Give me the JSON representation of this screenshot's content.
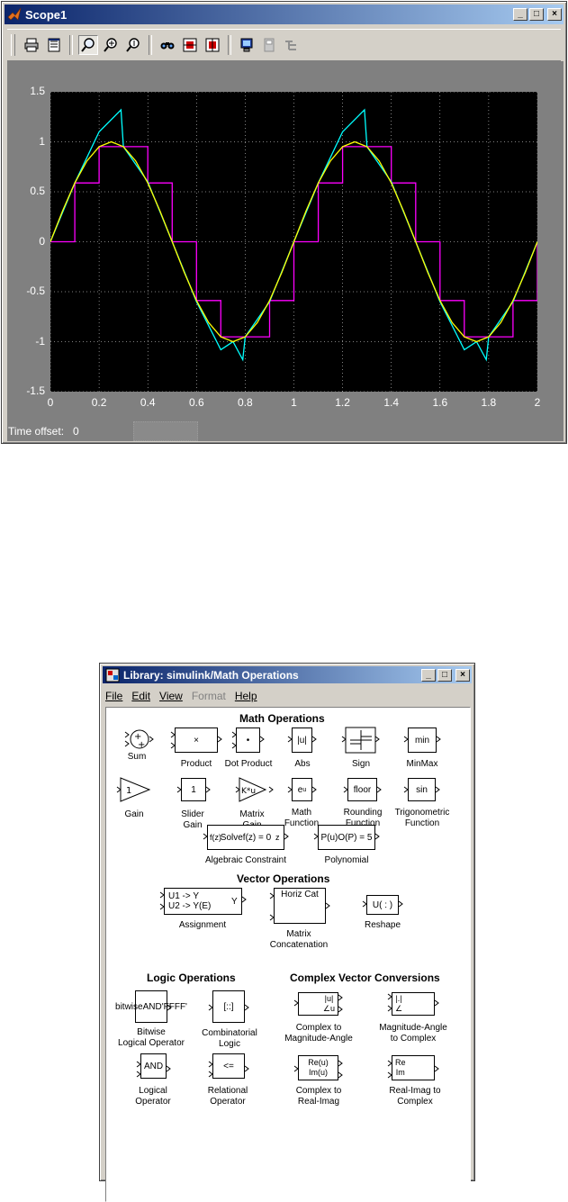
{
  "scope": {
    "title": "Scope1",
    "controls": {
      "minimize": "_",
      "maximize": "□",
      "close": "×"
    },
    "toolbar": [
      "print-icon",
      "parameters-icon",
      "zoom-icon",
      "zoom-x-icon",
      "zoom-y-icon",
      "autoscale-icon",
      "save-axes-icon",
      "restore-axes-icon",
      "floating-scope-icon",
      "lock-axes-icon",
      "signal-selection-icon"
    ],
    "time_offset_label": "Time offset:",
    "time_offset_value": "0",
    "colors": {
      "background": "#000000",
      "frame": "#808080",
      "sine": "#ffff00",
      "cyan_series": "#00ffff",
      "magenta_series": "#ff00ff"
    }
  },
  "chart_data": {
    "type": "line",
    "title": "",
    "xlim": [
      0,
      2
    ],
    "ylim": [
      -1.5,
      1.5
    ],
    "xticks": [
      "0",
      "0.2",
      "0.4",
      "0.6",
      "0.8",
      "1",
      "1.2",
      "1.4",
      "1.6",
      "1.8",
      "2"
    ],
    "yticks": [
      "1.5",
      "1",
      "0.5",
      "0",
      "-0.5",
      "-1",
      "-1.5"
    ],
    "grid": true,
    "series": [
      {
        "color": "#ffff00",
        "x": [
          0,
          0.05,
          0.1,
          0.15,
          0.2,
          0.25,
          0.3,
          0.35,
          0.4,
          0.45,
          0.5,
          0.55,
          0.6,
          0.65,
          0.7,
          0.75,
          0.8,
          0.85,
          0.9,
          0.95,
          1,
          1.05,
          1.1,
          1.15,
          1.2,
          1.25,
          1.3,
          1.35,
          1.4,
          1.45,
          1.5,
          1.55,
          1.6,
          1.65,
          1.7,
          1.75,
          1.8,
          1.85,
          1.9,
          1.95,
          2
        ],
        "y": [
          0,
          0.309,
          0.588,
          0.809,
          0.951,
          1,
          0.951,
          0.809,
          0.588,
          0.309,
          0,
          -0.309,
          -0.588,
          -0.809,
          -0.951,
          -1,
          -0.951,
          -0.809,
          -0.588,
          -0.309,
          0,
          0.309,
          0.588,
          0.809,
          0.951,
          1,
          0.951,
          0.809,
          0.588,
          0.309,
          0,
          -0.309,
          -0.588,
          -0.809,
          -0.951,
          -1,
          -0.951,
          -0.809,
          -0.588,
          -0.309,
          0
        ]
      },
      {
        "color": "#00ffff",
        "x": [
          0,
          0.1,
          0.2,
          0.29,
          0.3,
          0.4,
          0.5,
          0.6,
          0.7,
          0.75,
          0.79,
          0.8,
          0.9,
          1,
          1.1,
          1.2,
          1.29,
          1.3,
          1.4,
          1.5,
          1.6,
          1.7,
          1.75,
          1.79,
          1.8,
          1.9,
          2
        ],
        "y": [
          0,
          0.588,
          1.1,
          1.32,
          0.951,
          0.6,
          0,
          -0.6,
          -1.08,
          -1.0,
          -1.18,
          -0.951,
          -0.6,
          0,
          0.588,
          1.1,
          1.32,
          0.951,
          0.6,
          0,
          -0.6,
          -1.08,
          -1.0,
          -1.18,
          -0.951,
          -0.6,
          0
        ]
      },
      {
        "color": "#ff00ff",
        "x": [
          0,
          0.1,
          0.1,
          0.2,
          0.2,
          0.4,
          0.4,
          0.5,
          0.5,
          0.6,
          0.6,
          0.7,
          0.7,
          0.9,
          0.9,
          1,
          1,
          1.1,
          1.1,
          1.2,
          1.2,
          1.4,
          1.4,
          1.5,
          1.5,
          1.6,
          1.6,
          1.7,
          1.7,
          1.9,
          1.9,
          2,
          2
        ],
        "y": [
          0,
          0,
          0.588,
          0.588,
          0.951,
          0.951,
          0.588,
          0.588,
          0,
          0,
          -0.588,
          -0.588,
          -0.951,
          -0.951,
          -0.588,
          -0.588,
          0,
          0,
          0.588,
          0.588,
          0.951,
          0.951,
          0.588,
          0.588,
          0,
          0,
          -0.588,
          -0.588,
          -0.951,
          -0.951,
          -0.588,
          -0.588,
          0
        ]
      }
    ]
  },
  "library": {
    "title": "Library: simulink/Math Operations",
    "controls": {
      "minimize": "_",
      "maximize": "□",
      "close": "×"
    },
    "menu": [
      {
        "label": "File",
        "enabled": true
      },
      {
        "label": "Edit",
        "enabled": true
      },
      {
        "label": "View",
        "enabled": true
      },
      {
        "label": "Format",
        "enabled": false
      },
      {
        "label": "Help",
        "enabled": true
      }
    ],
    "headings": {
      "math": "Math Operations",
      "vector": "Vector Operations",
      "logic": "Logic Operations",
      "complex": "Complex Vector Conversions"
    },
    "blocks": {
      "sum": {
        "label": "Sum"
      },
      "product": {
        "label": "Product",
        "icon": "×"
      },
      "dot_product": {
        "label": "Dot Product",
        "icon": "•"
      },
      "abs": {
        "label": "Abs",
        "icon": "|u|"
      },
      "sign": {
        "label": "Sign"
      },
      "minmax": {
        "label": "MinMax",
        "icon": "min"
      },
      "gain": {
        "label": "Gain",
        "icon": "1"
      },
      "slider_gain": {
        "label1": "Slider",
        "label2": "Gain",
        "icon": "1"
      },
      "matrix_gain": {
        "label1": "Matrix",
        "label2": "Gain",
        "icon": "K*u"
      },
      "math_function": {
        "label1": "Math",
        "label2": "Function",
        "icon": "e",
        "icon_sup": "u"
      },
      "rounding_function": {
        "label1": "Rounding",
        "label2": "Function",
        "icon": "floor"
      },
      "trig_function": {
        "label1": "Trigonometric",
        "label2": "Function",
        "icon": "sin"
      },
      "algebraic_constraint": {
        "label": "Algebraic Constraint",
        "icon_line1": "Solve",
        "icon_line2": "f(z) = 0",
        "port_in": "f(z)",
        "port_out": "z"
      },
      "polynomial": {
        "label": "Polynomial",
        "icon_line1": "P(u)",
        "icon_line2": "O(P) = 5"
      },
      "assignment": {
        "label": "Assignment",
        "icon_line1": "U1 -> Y",
        "icon_line2": "U2 -> Y(E)",
        "port_out": "Y"
      },
      "matrix_concat": {
        "label1": "Matrix",
        "label2": "Concatenation",
        "icon": "Horiz Cat"
      },
      "reshape": {
        "label": "Reshape",
        "icon": "U( : )"
      },
      "bitwise": {
        "label1": "Bitwise",
        "label2": "Logical Operator",
        "icon_line1": "bitwise",
        "icon_line2": "AND",
        "icon_line3": "'FFFF'"
      },
      "combinatorial": {
        "label1": "Combinatorial",
        "label2": "Logic",
        "icon": "[::]"
      },
      "complex_mag_angle": {
        "label1": "Complex to",
        "label2": "Magnitude-Angle",
        "icon_top": "|u|",
        "icon_bottom": "∠u"
      },
      "mag_angle_complex": {
        "label1": "Magnitude-Angle",
        "label2": "to Complex",
        "icon_top": "|.|",
        "icon_bottom": "∠"
      },
      "logical_operator": {
        "label1": "Logical",
        "label2": "Operator",
        "icon": "AND"
      },
      "relational_operator": {
        "label1": "Relational",
        "label2": "Operator",
        "icon": "<="
      },
      "complex_real_imag": {
        "label1": "Complex to",
        "label2": "Real-Imag",
        "icon_top": "Re(u)",
        "icon_bottom": "Im(u)"
      },
      "real_imag_complex": {
        "label1": "Real-Imag to",
        "label2": "Complex",
        "icon_top": "Re",
        "icon_bottom": "Im"
      }
    }
  }
}
